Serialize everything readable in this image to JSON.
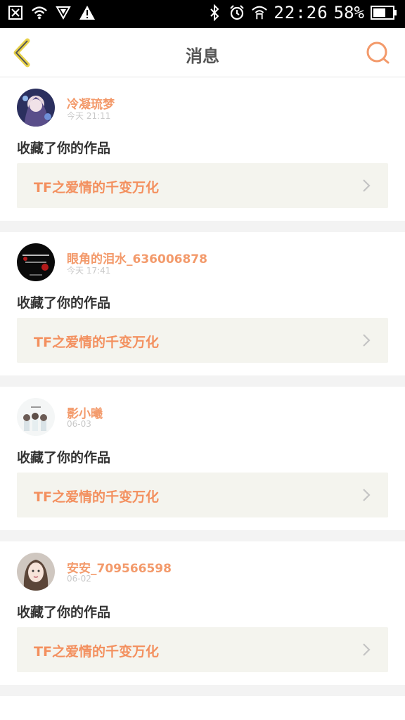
{
  "statusbar": {
    "time": "22:26",
    "battery_percent": "58%",
    "icons": [
      "close-box-icon",
      "wifi-icon",
      "vpn-shield-icon",
      "warning-icon",
      "bluetooth-icon",
      "alarm-icon",
      "wifi-call-icon",
      "battery-icon"
    ]
  },
  "header": {
    "title": "消息",
    "back_icon": "chevron-left-icon",
    "search_icon": "search-icon",
    "accent_color": "#f39a6b"
  },
  "messages": [
    {
      "user": "冷凝琉梦",
      "time": "今天 21:11",
      "action": "收藏了你的作品",
      "work_title": "TF之爱情的千变万化"
    },
    {
      "user": "眼角的泪水_636006878",
      "time": "今天 17:41",
      "action": "收藏了你的作品",
      "work_title": "TF之爱情的千变万化"
    },
    {
      "user": "影小曦",
      "time": "06-03",
      "action": "收藏了你的作品",
      "work_title": "TF之爱情的千变万化"
    },
    {
      "user": "安安_709566598",
      "time": "06-02",
      "action": "收藏了你的作品",
      "work_title": "TF之爱情的千变万化"
    }
  ]
}
